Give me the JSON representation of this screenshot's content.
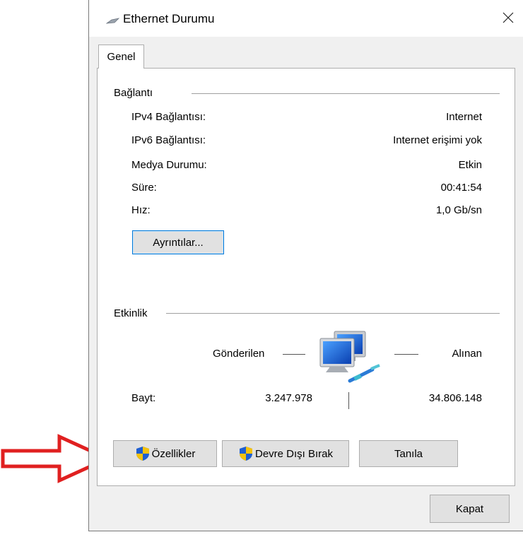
{
  "window": {
    "title": "Ethernet Durumu",
    "close_glyph": "✕"
  },
  "tabs": [
    {
      "label": "Genel",
      "selected": true
    }
  ],
  "connection": {
    "group_label": "Bağlantı",
    "rows": [
      {
        "label": "IPv4 Bağlantısı:",
        "value": "Internet"
      },
      {
        "label": "IPv6 Bağlantısı:",
        "value": "Internet erişimi yok"
      },
      {
        "label": "Medya Durumu:",
        "value": "Etkin"
      },
      {
        "label": "Süre:",
        "value": "00:41:54"
      },
      {
        "label": "Hız:",
        "value": "1,0 Gb/sn"
      }
    ],
    "details_button": "Ayrıntılar..."
  },
  "activity": {
    "group_label": "Etkinlik",
    "sent_label": "Gönderilen",
    "received_label": "Alınan",
    "bytes_label": "Bayt:",
    "bytes_sent": "3.247.978",
    "bytes_received": "34.806.148"
  },
  "buttons": {
    "properties": "Özellikler",
    "disable": "Devre Dışı Bırak",
    "diagnose": "Tanıla",
    "close": "Kapat"
  },
  "icons": {
    "title": "ethernet-cable-icon",
    "activity": "network-computers-icon",
    "shield": "uac-shield-icon",
    "annotation": "red-arrow-annotation"
  },
  "colors": {
    "accent": "#0078d7",
    "annotation_arrow": "#e02020",
    "window_bg": "#f0f0f0",
    "panel_bg": "#ffffff",
    "button_bg": "#e1e1e1"
  }
}
